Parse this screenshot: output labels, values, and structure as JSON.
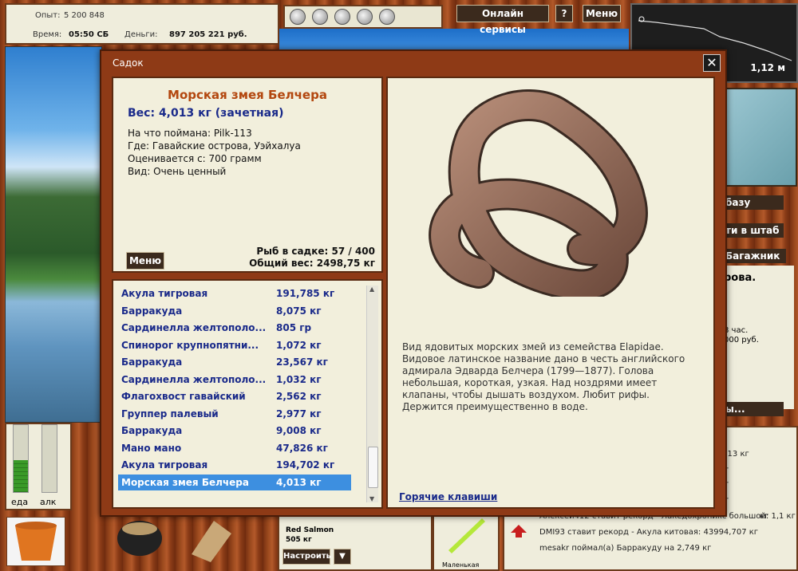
{
  "top_stats": {
    "exp_label": "Опыт:",
    "exp_value": "5 200 848",
    "time_label": "Время:",
    "time_value": "05:50 СБ",
    "money_label": "Деньги:",
    "money_value": "897 205 221 руб."
  },
  "top_buttons": {
    "online": "Онлайн сервисы",
    "help": "?",
    "menu": "Меню"
  },
  "depth_value": "1,12 м",
  "side_buttons": [
    "базу",
    "ти в штаб",
    "Багажник",
    "ы..."
  ],
  "side_panel": {
    "title": "рова.",
    "line1": "8 час.",
    "line2": "000 руб."
  },
  "gauges": {
    "food": "еда",
    "alc": "алк"
  },
  "bait": {
    "name": "Red Salmon",
    "amount": "505 кг",
    "configure": "Настроить",
    "arrow": "▼"
  },
  "lure_label": "Маленькая",
  "feed": [
    ",013 кг",
    "кг",
    "кг",
    "кг",
    "кг",
    "Алексей412 ставит рекорд - Лакедохроникс большой: 1,1 кг",
    "DMI93 ставит рекорд - Акула китовая: 43994,707 кг",
    "mesakr поймал(а) Барракуду на 2,749 кг"
  ],
  "dialog": {
    "title": "Садок",
    "close": "✕",
    "fish_name": "Морская змея Белчера",
    "fish_weight": "Вес: 4,013 кг (зачетная)",
    "caught_on": "На что поймана: Pilk-113",
    "where": "Где: Гавайские острова, Уэйхалуа",
    "rated_from": "Оценивается с: 700 грамм",
    "kind": "Вид: Очень ценный",
    "menu_button": "Меню",
    "fish_count": "Рыб в садке: 57 / 400",
    "total_weight": "Общий вес: 2498,75 кг",
    "description": "Вид ядовитых морских змей из семейства Elapidae. Видовое латинское название дано в честь английского адмирала Эдварда Белчера (1799—1877). Голова небольшая, короткая, узкая. Над ноздрями имеет клапаны, чтобы дышать воздухом. Любит рифы. Держится преимущественно в воде.",
    "hotkeys": "Горячие клавиши",
    "catch_list": [
      {
        "name": "Акула тигровая",
        "weight": "191,785 кг"
      },
      {
        "name": "Барракуда",
        "weight": "8,075 кг"
      },
      {
        "name": "Сардинелла желтополо...",
        "weight": "805 гр"
      },
      {
        "name": "Спинорог крупнопятни...",
        "weight": "1,072 кг"
      },
      {
        "name": "Барракуда",
        "weight": "23,567 кг"
      },
      {
        "name": "Сардинелла желтополо...",
        "weight": "1,032 кг"
      },
      {
        "name": "Флагохвост гавайский",
        "weight": "2,562 кг"
      },
      {
        "name": "Группер палевый",
        "weight": "2,977 кг"
      },
      {
        "name": "Барракуда",
        "weight": "9,008 кг"
      },
      {
        "name": "Мано мано",
        "weight": "47,826 кг"
      },
      {
        "name": "Акула тигровая",
        "weight": "194,702 кг"
      },
      {
        "name": "Морская змея Белчера",
        "weight": "4,013 кг",
        "selected": true
      }
    ]
  }
}
